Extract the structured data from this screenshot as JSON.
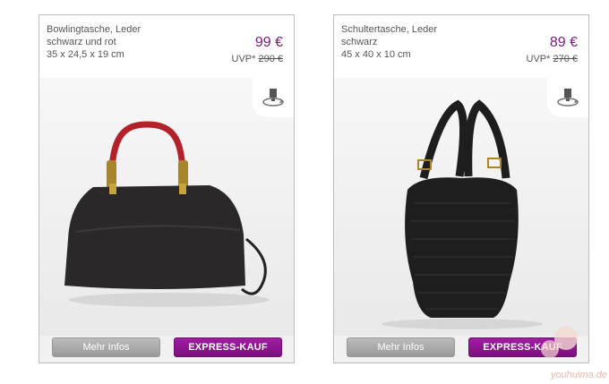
{
  "products": [
    {
      "title_lines": [
        "Bowlingtasche, Leder",
        "schwarz und rot",
        "35 x 24,5 x 19 cm"
      ],
      "price": "99 €",
      "uvp_label": "UVP*",
      "uvp_old": "290 €",
      "info_label": "Mehr Infos",
      "express_label": "EXPRESS-KAUF"
    },
    {
      "title_lines": [
        "Schultertasche, Leder",
        "schwarz",
        "45 x 40 x 10 cm"
      ],
      "price": "89 €",
      "uvp_label": "UVP*",
      "uvp_old": "270 €",
      "info_label": "Mehr Infos",
      "express_label": "EXPRESS-KAUF"
    }
  ],
  "watermark": "youhuima.de",
  "colors": {
    "price": "#7a1a7f",
    "express_button": "#8b148e",
    "info_button": "#a8a8a8",
    "handle_red": "#b3222a",
    "bag_dark": "#1f1e1e"
  },
  "icons": {
    "rotate": "rotate-view-icon"
  }
}
